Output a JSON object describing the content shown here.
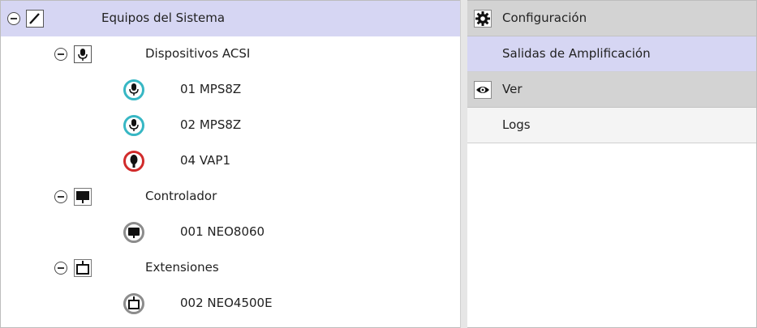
{
  "tree": {
    "root": {
      "label": "Equipos del Sistema",
      "icon": "pencil-icon"
    },
    "groups": [
      {
        "label": "Dispositivos ACSI",
        "icon": "microphone-icon",
        "items": [
          {
            "label": "01 MPS8Z",
            "icon": "microphone-icon",
            "ring_color": "#37b7c4"
          },
          {
            "label": "02 MPS8Z",
            "icon": "microphone-icon",
            "ring_color": "#37b7c4"
          },
          {
            "label": "04 VAP1",
            "icon": "speaker-icon",
            "ring_color": "#d12b2b"
          }
        ]
      },
      {
        "label": "Controlador",
        "icon": "monitor-icon",
        "items": [
          {
            "label": "001 NEO8060",
            "icon": "monitor-icon",
            "ring_color": "#8c8c8c"
          }
        ]
      },
      {
        "label": "Extensiones",
        "icon": "extension-box-icon",
        "items": [
          {
            "label": "002 NEO4500E",
            "icon": "extension-box-icon",
            "ring_color": "#8c8c8c"
          }
        ]
      }
    ]
  },
  "menu": {
    "configuracion": {
      "header": "Configuración",
      "icon": "gear-icon",
      "items": [
        "Salidas de Amplificación"
      ]
    },
    "ver": {
      "header": "Ver",
      "icon": "eye-icon",
      "items": [
        "Logs"
      ]
    }
  },
  "colors": {
    "selection": "#d6d6f3",
    "menu_header": "#d3d3d3"
  }
}
